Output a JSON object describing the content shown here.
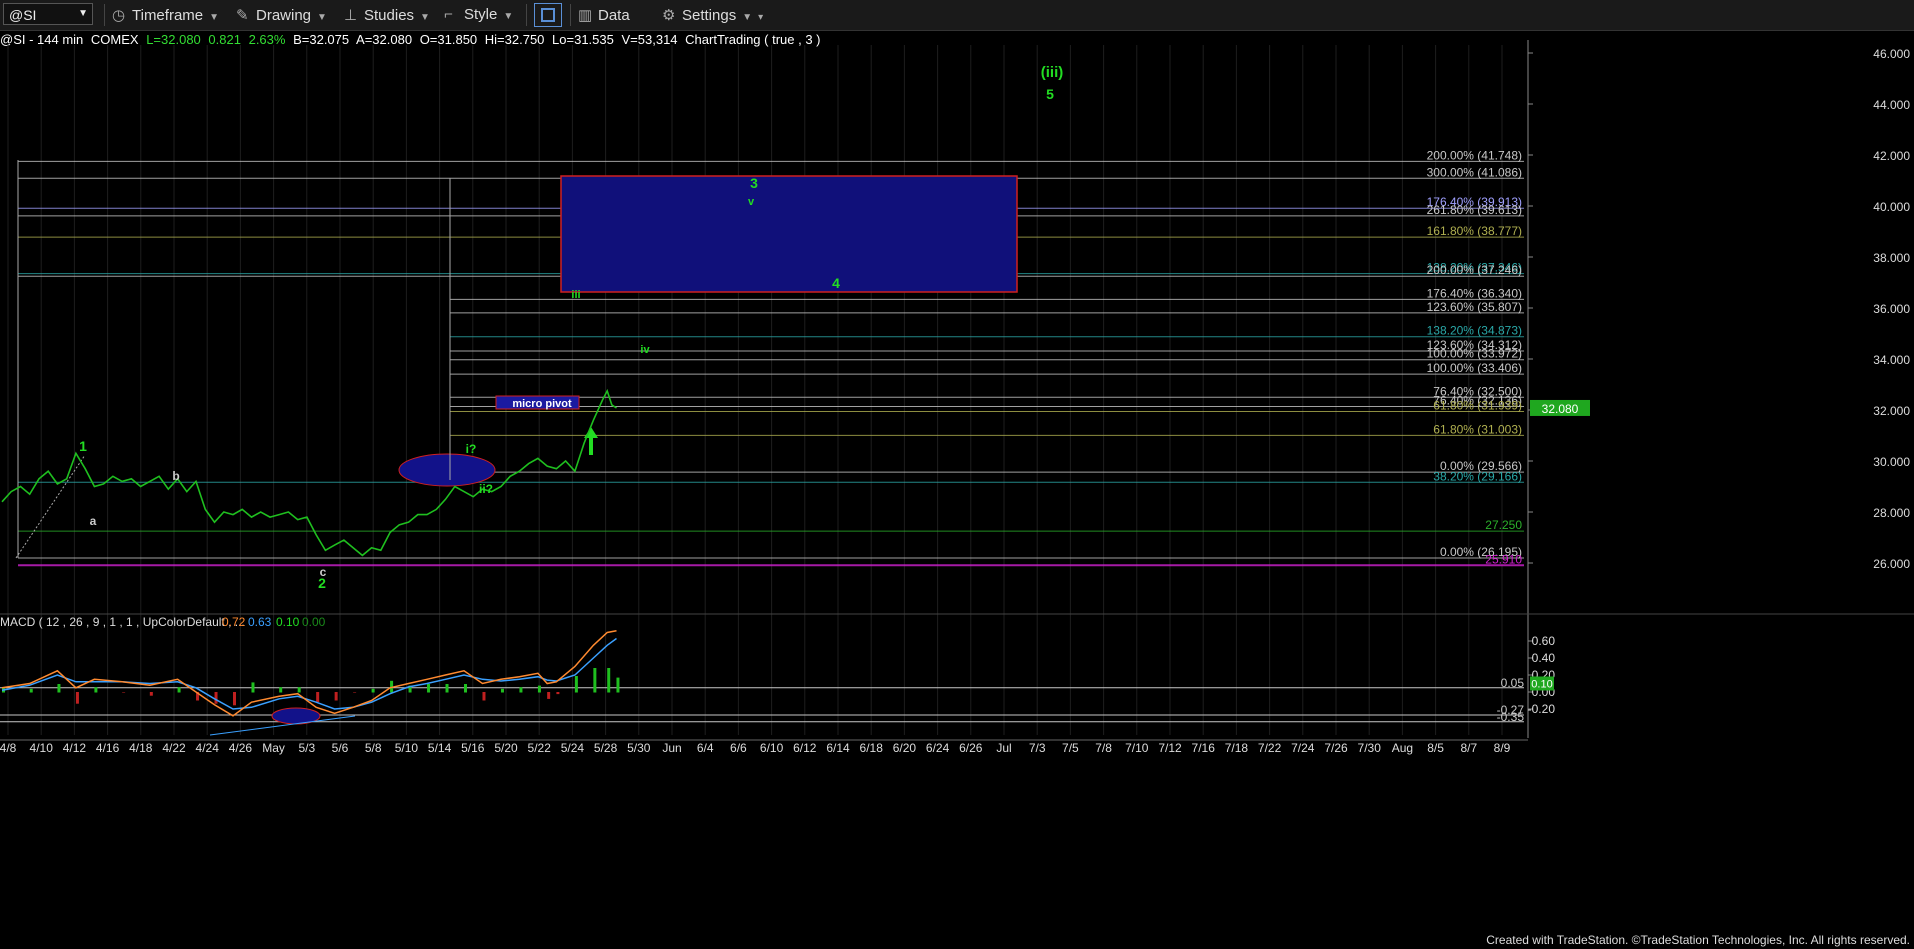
{
  "toolbar": {
    "symbol": "@SI",
    "timeframe": "Timeframe",
    "drawing": "Drawing",
    "studies": "Studies",
    "style": "Style",
    "data": "Data",
    "settings": "Settings"
  },
  "infobar": {
    "symbol_desc": "@SI - 144 min",
    "exchange": "COMEX",
    "last": "L=32.080",
    "change": "0.821",
    "change_pct": "2.63%",
    "bid": "B=32.075",
    "ask": "A=32.080",
    "open": "O=31.850",
    "high": "Hi=32.750",
    "low": "Lo=31.535",
    "volume": "V=53,314",
    "chart_trading": "ChartTrading ( true , 3 )"
  },
  "footer": "Created with TradeStation. ©TradeStation Technologies, Inc. All rights reserved.",
  "chart_data": [
    {
      "type": "line",
      "title": "@SI - 144 min",
      "y_axis": {
        "ticks": [
          26.0,
          28.0,
          30.0,
          32.0,
          34.0,
          36.0,
          38.0,
          40.0,
          42.0,
          44.0,
          46.0
        ],
        "tick_labels": [
          "26.000",
          "28.000",
          "30.000",
          "32.000",
          "34.000",
          "36.000",
          "38.000",
          "40.000",
          "42.000",
          "44.000",
          "46.000"
        ],
        "ylim": [
          24.0,
          46.8
        ]
      },
      "last_price_label": "32.080",
      "x_axis_labels": [
        "4/8",
        "4/10",
        "4/12",
        "4/16",
        "4/18",
        "4/22",
        "4/24",
        "4/26",
        "May",
        "5/3",
        "5/6",
        "5/8",
        "5/10",
        "5/14",
        "5/16",
        "5/20",
        "5/22",
        "5/24",
        "5/28",
        "5/30",
        "Jun",
        "6/4",
        "6/6",
        "6/10",
        "6/12",
        "6/14",
        "6/18",
        "6/20",
        "6/24",
        "6/26",
        "Jul",
        "7/3",
        "7/5",
        "7/8",
        "7/10",
        "7/12",
        "7/16",
        "7/18",
        "7/22",
        "7/24",
        "7/26",
        "7/30",
        "Aug",
        "8/5",
        "8/7",
        "8/9"
      ],
      "price_path": [
        [
          0,
          28.4
        ],
        [
          2,
          28.8
        ],
        [
          4,
          29.0
        ],
        [
          6,
          28.7
        ],
        [
          8,
          29.3
        ],
        [
          10,
          29.6
        ],
        [
          12,
          29.1
        ],
        [
          14,
          29.3
        ],
        [
          16,
          30.3
        ],
        [
          18,
          29.7
        ],
        [
          20,
          29.0
        ],
        [
          22,
          29.1
        ],
        [
          24,
          29.4
        ],
        [
          26,
          29.2
        ],
        [
          28,
          29.3
        ],
        [
          30,
          29.0
        ],
        [
          32,
          29.2
        ],
        [
          34,
          29.4
        ],
        [
          36,
          28.9
        ],
        [
          38,
          29.3
        ],
        [
          40,
          28.8
        ],
        [
          42,
          29.2
        ],
        [
          44,
          28.1
        ],
        [
          46,
          27.6
        ],
        [
          48,
          28.0
        ],
        [
          50,
          27.9
        ],
        [
          52,
          28.1
        ],
        [
          54,
          27.8
        ],
        [
          56,
          28.0
        ],
        [
          58,
          27.8
        ],
        [
          60,
          27.9
        ],
        [
          62,
          28.0
        ],
        [
          64,
          27.7
        ],
        [
          66,
          27.8
        ],
        [
          68,
          27.1
        ],
        [
          70,
          26.5
        ],
        [
          72,
          26.7
        ],
        [
          74,
          26.9
        ],
        [
          76,
          26.6
        ],
        [
          78,
          26.3
        ],
        [
          80,
          26.6
        ],
        [
          82,
          26.5
        ],
        [
          84,
          27.2
        ],
        [
          86,
          27.5
        ],
        [
          88,
          27.6
        ],
        [
          90,
          27.9
        ],
        [
          92,
          27.9
        ],
        [
          94,
          28.1
        ],
        [
          96,
          28.5
        ],
        [
          98,
          29.0
        ],
        [
          100,
          28.8
        ],
        [
          102,
          28.6
        ],
        [
          104,
          28.9
        ],
        [
          106,
          28.8
        ],
        [
          108,
          29.0
        ],
        [
          110,
          29.4
        ],
        [
          112,
          29.6
        ],
        [
          114,
          29.9
        ],
        [
          116,
          30.1
        ],
        [
          118,
          29.8
        ],
        [
          120,
          29.7
        ],
        [
          122,
          30.0
        ],
        [
          124,
          29.6
        ],
        [
          126,
          30.7
        ],
        [
          128,
          31.6
        ],
        [
          130,
          32.4
        ],
        [
          131,
          32.75
        ],
        [
          132,
          32.2
        ],
        [
          133,
          32.08
        ]
      ],
      "horizontal_levels": [
        {
          "label": "200.00% (41.748)",
          "value": 41.748
        },
        {
          "label": "300.00% (41.086)",
          "value": 41.086
        },
        {
          "label": "176.40% (39.913)",
          "value": 39.913
        },
        {
          "label": "261.80% (39.613)",
          "value": 39.613
        },
        {
          "label": "161.80% (38.777)",
          "value": 38.777
        },
        {
          "label": "138.20% (37.346)",
          "value": 37.346
        },
        {
          "label": "200.00% (37.246)",
          "value": 37.246
        },
        {
          "label": "176.40% (36.340)",
          "value": 36.34
        },
        {
          "label": "123.60% (35.807)",
          "value": 35.807
        },
        {
          "label": "138.20% (34.873)",
          "value": 34.873
        },
        {
          "label": "123.60% (34.312)",
          "value": 34.312
        },
        {
          "label": "100.00% (33.972)",
          "value": 33.972
        },
        {
          "label": "100.00% (33.406)",
          "value": 33.406
        },
        {
          "label": "76.40% (32.500)",
          "value": 32.5
        },
        {
          "label": "76.40% (32.136)",
          "value": 32.136
        },
        {
          "label": "61.80% (31.939)",
          "value": 31.939
        },
        {
          "label": "61.80% (31.003)",
          "value": 31.003
        },
        {
          "label": "0.00% (29.566)",
          "value": 29.566
        },
        {
          "label": "38.20% (29.166)",
          "value": 29.166
        },
        {
          "label": "27.250",
          "value": 27.25
        },
        {
          "label": "0.00% (26.195)",
          "value": 26.195
        },
        {
          "label": "25.910",
          "value": 25.91
        }
      ],
      "annotations": [
        "(iii)",
        "5",
        "3",
        "v",
        "4",
        "iii",
        "iv",
        "micro pivot",
        "i?",
        "ii?",
        "1",
        "b",
        "a",
        "c",
        "2"
      ]
    },
    {
      "type": "line",
      "title": "MACD ( 12 , 26 , 9 , 1 , 1 , UpColorDefault , ...",
      "legend_values": [
        "0.72",
        "0.63",
        "0.10",
        "0.00"
      ],
      "y_axis": {
        "ticks": [
          0.6,
          0.4,
          0.2,
          0.0,
          -0.2
        ],
        "tick_labels": [
          "0.60",
          "0.40",
          "0.20",
          "0.00",
          "-0.20"
        ]
      },
      "levels": [
        {
          "label": "0.05",
          "value": 0.05
        },
        {
          "label": "-0.27",
          "value": -0.27
        },
        {
          "label": "-0.35",
          "value": -0.35
        }
      ],
      "current_value_label": "0.10",
      "macd": [
        [
          0,
          0.05
        ],
        [
          6,
          0.1
        ],
        [
          12,
          0.25
        ],
        [
          16,
          0.05
        ],
        [
          20,
          0.15
        ],
        [
          26,
          0.12
        ],
        [
          32,
          0.08
        ],
        [
          38,
          0.15
        ],
        [
          42,
          0.0
        ],
        [
          46,
          -0.15
        ],
        [
          50,
          -0.28
        ],
        [
          54,
          -0.12
        ],
        [
          60,
          -0.05
        ],
        [
          64,
          -0.02
        ],
        [
          68,
          -0.18
        ],
        [
          72,
          -0.25
        ],
        [
          76,
          -0.18
        ],
        [
          80,
          -0.1
        ],
        [
          84,
          0.05
        ],
        [
          88,
          0.1
        ],
        [
          92,
          0.15
        ],
        [
          96,
          0.2
        ],
        [
          100,
          0.25
        ],
        [
          104,
          0.1
        ],
        [
          108,
          0.15
        ],
        [
          112,
          0.18
        ],
        [
          116,
          0.22
        ],
        [
          118,
          0.1
        ],
        [
          120,
          0.12
        ],
        [
          124,
          0.3
        ],
        [
          128,
          0.55
        ],
        [
          131,
          0.7
        ],
        [
          133,
          0.72
        ]
      ],
      "signal": [
        [
          0,
          0.02
        ],
        [
          6,
          0.08
        ],
        [
          12,
          0.2
        ],
        [
          16,
          0.12
        ],
        [
          20,
          0.12
        ],
        [
          26,
          0.12
        ],
        [
          32,
          0.1
        ],
        [
          38,
          0.12
        ],
        [
          42,
          0.05
        ],
        [
          46,
          -0.08
        ],
        [
          50,
          -0.2
        ],
        [
          54,
          -0.18
        ],
        [
          60,
          -0.08
        ],
        [
          64,
          -0.05
        ],
        [
          68,
          -0.12
        ],
        [
          72,
          -0.2
        ],
        [
          76,
          -0.18
        ],
        [
          80,
          -0.12
        ],
        [
          84,
          -0.02
        ],
        [
          88,
          0.06
        ],
        [
          92,
          0.1
        ],
        [
          96,
          0.15
        ],
        [
          100,
          0.2
        ],
        [
          104,
          0.15
        ],
        [
          108,
          0.13
        ],
        [
          112,
          0.15
        ],
        [
          116,
          0.18
        ],
        [
          118,
          0.14
        ],
        [
          120,
          0.13
        ],
        [
          124,
          0.2
        ],
        [
          128,
          0.4
        ],
        [
          131,
          0.55
        ],
        [
          133,
          0.63
        ]
      ]
    }
  ]
}
